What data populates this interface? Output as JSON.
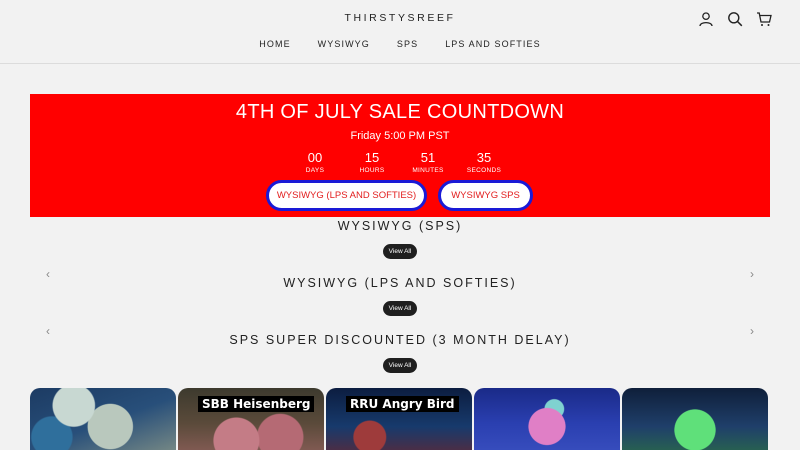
{
  "header": {
    "logo": "THIRSTYSREEF",
    "nav": [
      "HOME",
      "WYSIWYG",
      "SPS",
      "LPS AND SOFTIES"
    ],
    "icons": [
      "account-icon",
      "search-icon",
      "cart-icon"
    ]
  },
  "banner": {
    "title": "4TH OF JULY SALE COUNTDOWN",
    "subtitle": "Friday 5:00 PM PST",
    "countdown": [
      {
        "value": "00",
        "unit": "DAYS"
      },
      {
        "value": "15",
        "unit": "HOURS"
      },
      {
        "value": "51",
        "unit": "MINUTES"
      },
      {
        "value": "35",
        "unit": "SECONDS"
      }
    ],
    "buttons": [
      "WYSIWYG (LPS AND SOFTIES)",
      "WYSIWYG SPS"
    ],
    "bg_color": "#ff0000",
    "button_border_color": "#1a1ad6"
  },
  "sections": [
    {
      "title": "WYSIWYG (SPS)",
      "view_all": "View All"
    },
    {
      "title": "WYSIWYG (LPS AND SOFTIES)",
      "view_all": "View All"
    },
    {
      "title": "SPS SUPER DISCOUNTED (3 MONTH DELAY)",
      "view_all": "View All"
    }
  ],
  "products": [
    {
      "label": ""
    },
    {
      "label": "SBB Heisenberg"
    },
    {
      "label": "RRU Angry Bird"
    },
    {
      "label": ""
    },
    {
      "label": ""
    }
  ]
}
